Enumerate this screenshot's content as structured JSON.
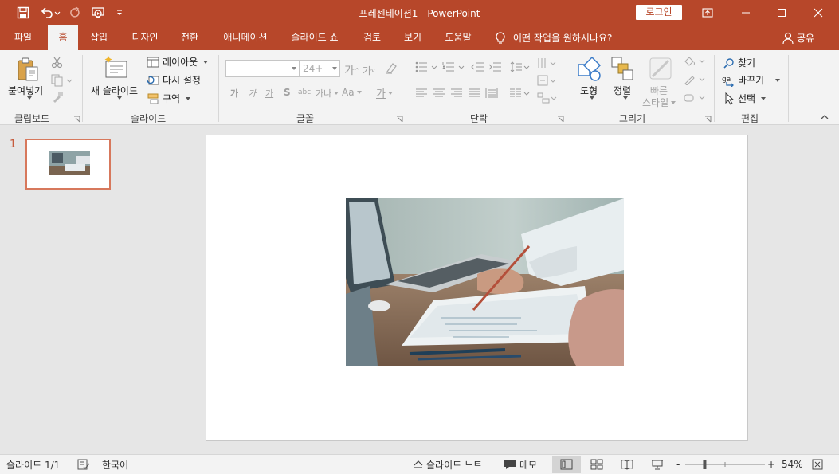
{
  "window": {
    "title": "프레젠테이션1  -  PowerPoint",
    "login_label": "로그인"
  },
  "tabs": [
    {
      "label": "파일"
    },
    {
      "label": "홈"
    },
    {
      "label": "삽입"
    },
    {
      "label": "디자인"
    },
    {
      "label": "전환"
    },
    {
      "label": "애니메이션"
    },
    {
      "label": "슬라이드 쇼"
    },
    {
      "label": "검토"
    },
    {
      "label": "보기"
    },
    {
      "label": "도움말"
    }
  ],
  "active_tab": "홈",
  "tell_me": "어떤 작업을 원하시나요?",
  "share_label": "공유",
  "ribbon": {
    "clipboard": {
      "group_label": "클립보드",
      "paste_label": "붙여넣기"
    },
    "slides": {
      "group_label": "슬라이드",
      "new_slide_label": "새 슬라이드",
      "layout_label": "레이아웃",
      "reset_label": "다시 설정",
      "section_label": "구역"
    },
    "font": {
      "group_label": "글꼴",
      "font_name": "",
      "font_size": "24+",
      "grow_label": "가",
      "shrink_label": "가",
      "bold_label": "가",
      "italic_label": "가",
      "underline_label": "가",
      "shadow_label": "S",
      "strike_label": "abc",
      "spacing_label": "가나",
      "case_label": "Aa",
      "color_label": "가"
    },
    "paragraph": {
      "group_label": "단락"
    },
    "drawing": {
      "group_label": "그리기",
      "shapes_label": "도형",
      "arrange_label": "정렬",
      "quick_styles_label_1": "빠른",
      "quick_styles_label_2": "스타일"
    },
    "editing": {
      "group_label": "편집",
      "find_label": "찾기",
      "replace_label": "바꾸기",
      "select_label": "선택"
    }
  },
  "slide_panel": {
    "slides": [
      {
        "number": "1"
      }
    ]
  },
  "status": {
    "slide_info": "슬라이드 1/1",
    "language": "한국어",
    "notes_label": "슬라이드 노트",
    "comments_label": "메모",
    "zoom_minus": "-",
    "zoom_plus": "+",
    "zoom_level": "54%",
    "zoom_fraction": 0.54
  },
  "colors": {
    "accent": "#b7472a",
    "thumbnail_border": "#d7785c",
    "ribbon_bg": "#f3f3f3",
    "workspace_bg": "#e6e6e6"
  }
}
